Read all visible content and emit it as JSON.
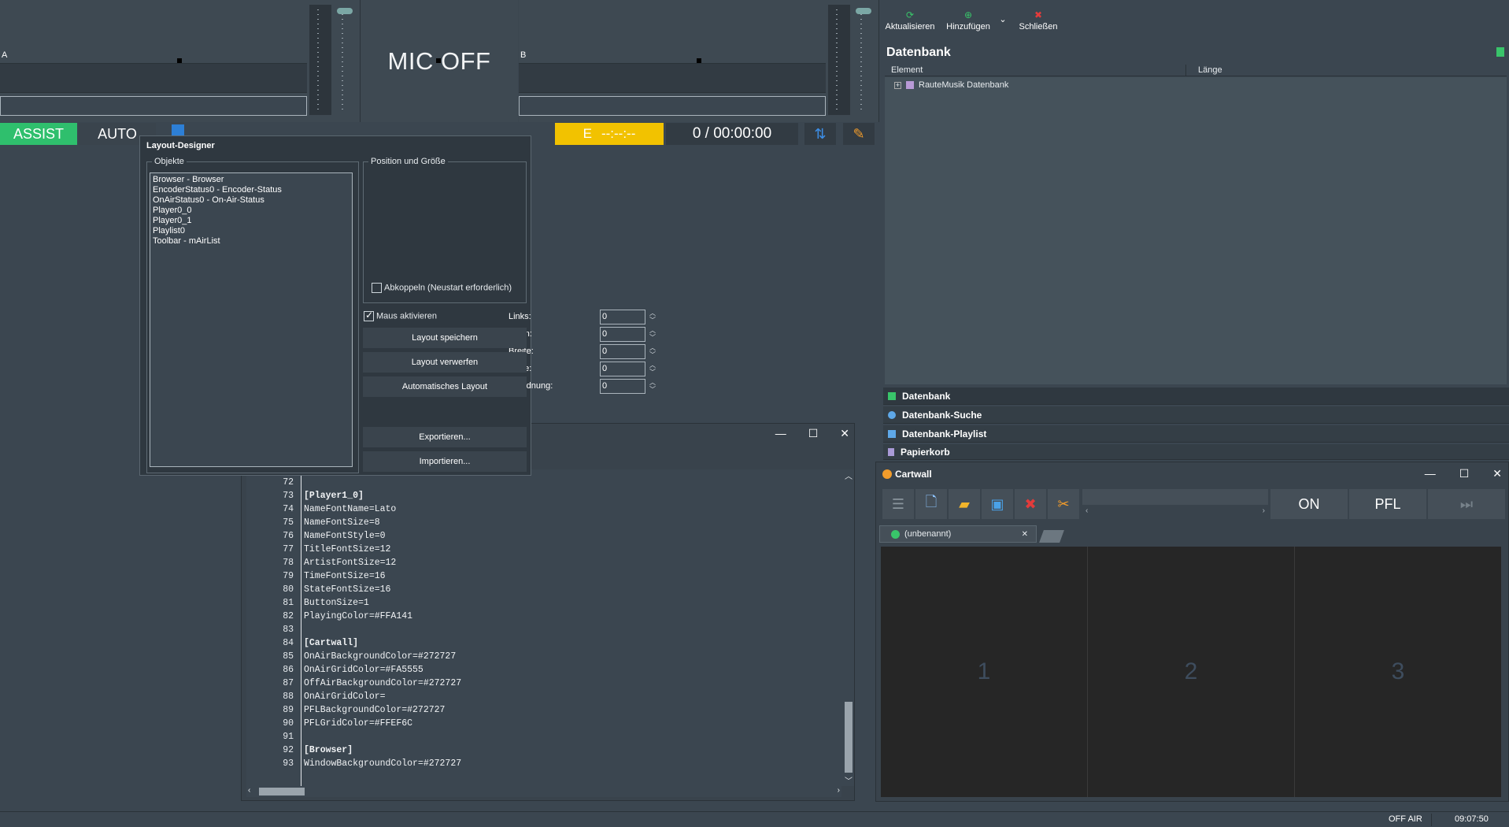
{
  "player_a": {
    "letter": "A"
  },
  "player_b": {
    "letter": "B"
  },
  "mic": {
    "label": "MIC OFF"
  },
  "status_row": {
    "assist": "ASSIST",
    "auto": "AUTO",
    "encoder_letter": "E",
    "encoder_time": "--:--:--",
    "time": "0 / 00:00:00"
  },
  "designer": {
    "title": "Layout-Designer",
    "objects_legend": "Objekte",
    "objects": [
      "Browser - Browser",
      "EncoderStatus0 - Encoder-Status",
      "OnAirStatus0 - On-Air-Status",
      "Player0_0",
      "Player0_1",
      "Playlist0",
      "Toolbar - mAirList"
    ],
    "pos_legend": "Position und Größe",
    "fields": [
      {
        "label": "Links:",
        "value": "0"
      },
      {
        "label": "Oben:",
        "value": "0"
      },
      {
        "label": "Breite:",
        "value": "0"
      },
      {
        "label": "Höhe:",
        "value": "0"
      },
      {
        "label": "Z-Ordnung:",
        "value": "0"
      }
    ],
    "detach_label": "Abkoppeln (Neustart erforderlich)",
    "mouse_label": "Maus aktivieren",
    "buttons": [
      "Layout speichern",
      "Layout verwerfen",
      "Automatisches Layout",
      "Exportieren...",
      "Importieren..."
    ]
  },
  "editor": {
    "lines": [
      {
        "n": "72",
        "t": ""
      },
      {
        "n": "73",
        "t": "[Player1_0]"
      },
      {
        "n": "74",
        "t": "NameFontName=Lato"
      },
      {
        "n": "75",
        "t": "NameFontSize=8"
      },
      {
        "n": "76",
        "t": "NameFontStyle=0"
      },
      {
        "n": "77",
        "t": "TitleFontSize=12"
      },
      {
        "n": "78",
        "t": "ArtistFontSize=12"
      },
      {
        "n": "79",
        "t": "TimeFontSize=16"
      },
      {
        "n": "80",
        "t": "StateFontSize=16"
      },
      {
        "n": "81",
        "t": "ButtonSize=1"
      },
      {
        "n": "82",
        "t": "PlayingColor=#FFA141"
      },
      {
        "n": "83",
        "t": ""
      },
      {
        "n": "84",
        "t": "[Cartwall]"
      },
      {
        "n": "85",
        "t": "OnAirBackgroundColor=#272727"
      },
      {
        "n": "86",
        "t": "OnAirGridColor=#FA5555"
      },
      {
        "n": "87",
        "t": "OffAirBackgroundColor=#272727"
      },
      {
        "n": "88",
        "t": "OnAirGridColor="
      },
      {
        "n": "89",
        "t": "PFLBackgroundColor=#272727"
      },
      {
        "n": "90",
        "t": "PFLGridColor=#FFEF6C"
      },
      {
        "n": "91",
        "t": ""
      },
      {
        "n": "92",
        "t": "[Browser]"
      },
      {
        "n": "93",
        "t": "WindowBackgroundColor=#272727"
      }
    ]
  },
  "toolbar": {
    "refresh": "Aktualisieren",
    "add": "Hinzufügen",
    "close": "Schließen"
  },
  "database": {
    "title": "Datenbank",
    "col_element": "Element",
    "col_length": "Länge",
    "root_item": "RauteMusik Datenbank",
    "tabs": [
      "Datenbank",
      "Datenbank-Suche",
      "Datenbank-Playlist",
      "Papierkorb"
    ]
  },
  "cartwall": {
    "title": "Cartwall",
    "on": "ON",
    "pfl": "PFL",
    "tab_label": "(unbenannt)",
    "cells": [
      "1",
      "2",
      "3"
    ]
  },
  "statusbar": {
    "onair": "OFF AIR",
    "clock": "09:07:50"
  },
  "colors": {
    "assist": "#2fbf6d",
    "encoder": "#f2c200",
    "background": "#3b4650"
  }
}
